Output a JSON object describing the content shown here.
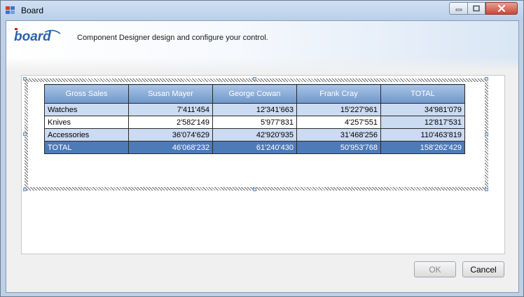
{
  "window": {
    "title": "Board",
    "controls": [
      "minimize-icon",
      "maximize-icon",
      "close-icon"
    ]
  },
  "banner": {
    "logo_text": "board",
    "description": "Component Designer design and configure your control."
  },
  "grid": {
    "columns": [
      "Gross Sales",
      "Susan Mayer",
      "George Cowan",
      "Frank Cray",
      "TOTAL"
    ],
    "rows": [
      [
        "Watches",
        "7'411'454",
        "12'341'663",
        "15'227'961",
        "34'981'079"
      ],
      [
        "Knives",
        "2'582'149",
        "5'977'831",
        "4'257'551",
        "12'817'531"
      ],
      [
        "Accessories",
        "36'074'629",
        "42'920'935",
        "31'468'256",
        "110'463'819"
      ]
    ],
    "total_row": [
      "TOTAL",
      "46'068'232",
      "61'240'430",
      "50'953'768",
      "158'262'429"
    ]
  },
  "buttons": {
    "ok": "OK",
    "cancel": "Cancel"
  },
  "colors": {
    "header_top": "#a9c3e4",
    "header_bottom": "#6f97cc",
    "alt_row": "#cbdbf1",
    "total_row": "#4c7bb8",
    "logo_blue": "#2a62b0",
    "logo_red": "#d02020"
  }
}
